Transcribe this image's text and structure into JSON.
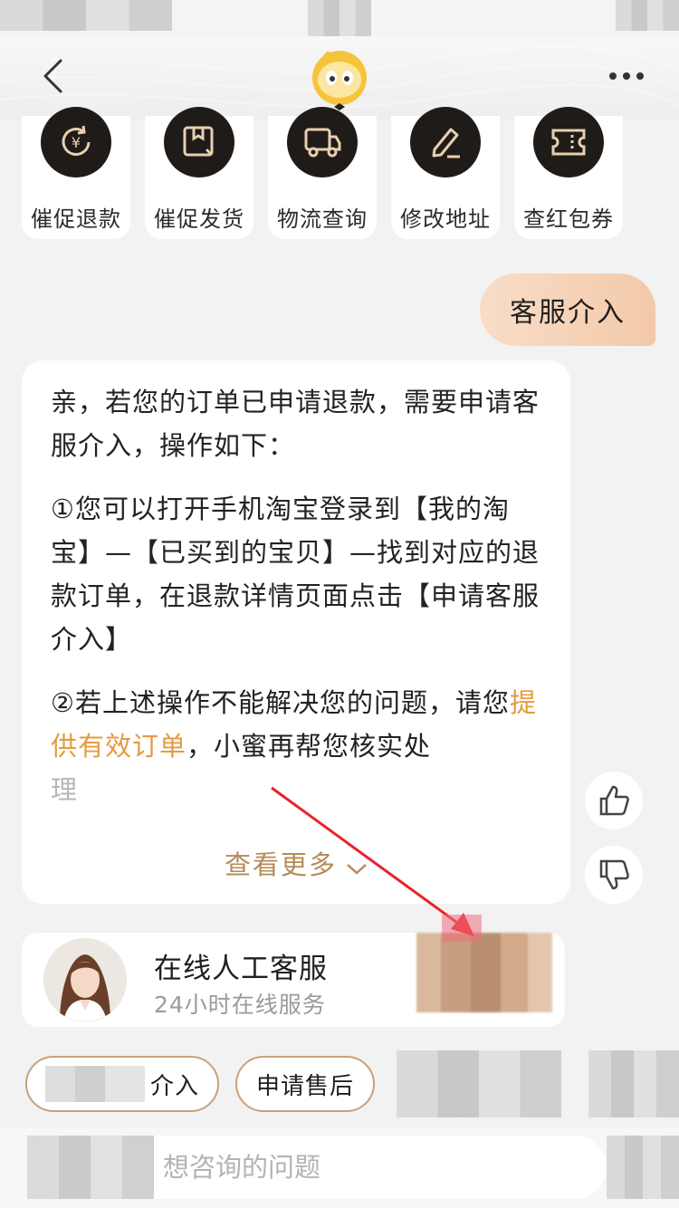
{
  "header": {
    "back_icon": "chevron-left-icon",
    "mascot_icon": "mascot-icon",
    "more_icon": "more-dots-icon"
  },
  "quick_actions": [
    {
      "label": "催促退款",
      "icon": "refund-yen-icon"
    },
    {
      "label": "催促发货",
      "icon": "package-box-icon"
    },
    {
      "label": "物流查询",
      "icon": "delivery-truck-icon"
    },
    {
      "label": "修改地址",
      "icon": "edit-pencil-icon"
    },
    {
      "label": "查红包券",
      "icon": "coupon-ticket-icon"
    }
  ],
  "chat": {
    "user_message": "客服介入",
    "bot_message": {
      "para1": "亲，若您的订单已申请退款，需要申请客服介入，操作如下：",
      "para2": "①您可以打开手机淘宝登录到【我的淘宝】—【已买到的宝贝】—找到对应的退款订单，在退款详情页面点击【申请客服介入】",
      "para3_prefix": "②若上述操作不能解决您的问题，请您",
      "para3_link": "提供有效订单",
      "para3_suffix": "，小蜜再帮您核实处",
      "para3_faded": "理",
      "see_more": "查看更多"
    },
    "feedback": {
      "like_icon": "thumbs-up-icon",
      "dislike_icon": "thumbs-down-icon"
    }
  },
  "agent": {
    "title": "在线人工客服",
    "subtitle": "24小时在线服务"
  },
  "chips": [
    {
      "label": "介入"
    },
    {
      "label": "申请售后"
    }
  ],
  "input": {
    "placeholder": "想咨询的问题"
  },
  "colors": {
    "accent_gold": "#b38b5a",
    "highlight_orange": "#e59a3e",
    "annotation_red": "#e8232b"
  }
}
